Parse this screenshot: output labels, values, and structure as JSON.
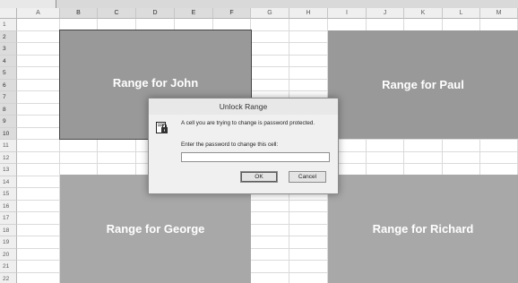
{
  "columns": [
    "A",
    "B",
    "C",
    "D",
    "E",
    "F",
    "G",
    "H",
    "I",
    "J",
    "K",
    "L",
    "M"
  ],
  "selected_columns": [
    "B",
    "C",
    "D",
    "E",
    "F"
  ],
  "rows": [
    "1",
    "2",
    "3",
    "4",
    "5",
    "6",
    "7",
    "8",
    "9",
    "10",
    "11",
    "12",
    "13",
    "14",
    "15",
    "16",
    "17",
    "18",
    "19",
    "20",
    "21",
    "22"
  ],
  "selected_rows": [
    "2",
    "3",
    "4",
    "5",
    "6",
    "7",
    "8",
    "9",
    "10"
  ],
  "ranges": {
    "john": "Range for John",
    "paul": "Range for Paul",
    "george": "Range for George",
    "richard": "Range for Richard"
  },
  "dialog": {
    "title": "Unlock Range",
    "message": "A cell you are trying to change is password protected.",
    "prompt": "Enter the password to change this cell:",
    "password_value": "",
    "ok_label": "OK",
    "cancel_label": "Cancel"
  }
}
